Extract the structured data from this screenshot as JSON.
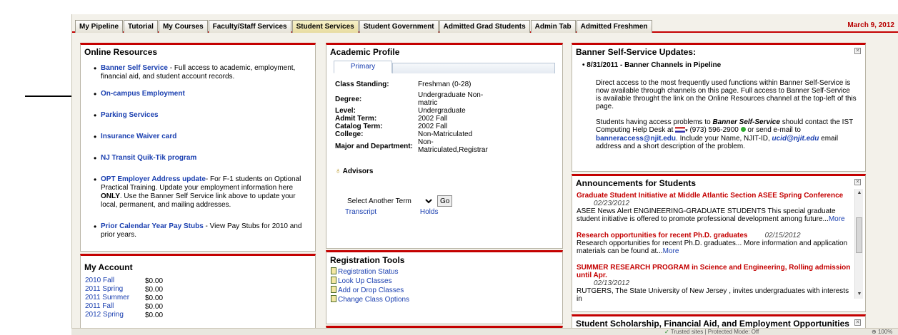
{
  "tabs": [
    "My Pipeline",
    "Tutorial",
    "My Courses",
    "Faculty/Staff Services",
    "Student Services",
    "Student Government",
    "Admitted Grad Students",
    "Admin Tab",
    "Admitted Freshmen"
  ],
  "active_tab": "Student Services",
  "date": "March 9, 2012",
  "online_resources": {
    "title": "Online Resources",
    "items": [
      {
        "link": "Banner Self Service",
        "text": " - Full access to academic, employment, financial aid, and student account records."
      },
      {
        "link": "On-campus Employment",
        "text": ""
      },
      {
        "link": "Parking Services",
        "text": ""
      },
      {
        "link": "Insurance Waiver card",
        "text": ""
      },
      {
        "link": "NJ Transit Quik-Tik program",
        "text": ""
      },
      {
        "link": "OPT Employer Address update",
        "text": "- For F-1 students on Optional Practical Training.  Update your employment information here ",
        "bold": "ONLY",
        "text2": ".  Use the Banner Self Service link above to update your local, permanent, and mailing addresses."
      },
      {
        "link": "Prior Calendar Year Pay Stubs",
        "text": " - View Pay Stubs for 2010 and prior years."
      }
    ]
  },
  "my_account": {
    "title": "My Account",
    "rows": [
      {
        "term": "2010 Fall",
        "amount": "$0.00"
      },
      {
        "term": "2011 Spring",
        "amount": "$0.00"
      },
      {
        "term": "2011 Summer",
        "amount": "$0.00"
      },
      {
        "term": "2011 Fall",
        "amount": "$0.00"
      },
      {
        "term": "2012 Spring",
        "amount": "$0.00"
      }
    ]
  },
  "academic_profile": {
    "title": "Academic Profile",
    "tab": "Primary",
    "rows": [
      {
        "k": "Class Standing:",
        "v": "Freshman (0-28)"
      },
      {
        "k": "Degree:",
        "v": "Undergraduate Non-matric"
      },
      {
        "k": "Level:",
        "v": "Undergraduate"
      },
      {
        "k": "Admit Term:",
        "v": "2002 Fall"
      },
      {
        "k": "Catalog Term:",
        "v": "2002 Fall"
      },
      {
        "k": "College:",
        "v": "Non-Matriculated"
      },
      {
        "k": "Major and Department:",
        "v": "Non-Matriculated,Registrar"
      }
    ],
    "advisors": "Advisors",
    "select_term": "Select Another Term",
    "go": "Go",
    "transcript": "Transcript",
    "holds": "Holds"
  },
  "registration_tools": {
    "title": "Registration Tools",
    "items": [
      "Registration Status",
      "Look Up Classes",
      "Add or Drop Classes",
      "Change Class Options"
    ]
  },
  "banner_updates": {
    "title": "Banner Self-Service Updates:",
    "item_title": "8/31/2011 - Banner Channels in Pipeline",
    "para1": "Direct access to the most frequently used functions within Banner Self-Service is now available through channels on this page. Full access to Banner Self-Service is available throught the link on the Online Resources channel at the top-left of this page.",
    "p2_a": "Students having access problems to ",
    "p2_b": "Banner Self-Service",
    "p2_c": " should contact the IST Computing Help Desk at ",
    "phone": "(973) 596-2900",
    "p2_d": " or send e-mail to ",
    "email": "banneraccess@njit.edu",
    "p2_e": ". Include your Name, NJIT-ID, ",
    "email2": "ucid@njit.edu",
    "p2_f": " email address and a short description of the problem."
  },
  "announcements": {
    "title": "Announcements for Students",
    "items": [
      {
        "title": "Graduate Student Initiative at Middle Atlantic Section ASEE Spring Conference",
        "date": "02/23/2012",
        "body": "ASEE News Alert ENGINEERING-GRADUATE STUDENTS This special graduate student initiative is offered to promote professional development among future...",
        "more": "More"
      },
      {
        "title": "Research opportunities for recent Ph.D. graduates",
        "date": "02/15/2012",
        "body": "Research opportunities for recent Ph.D. graduates... More information and application materials can be found at...",
        "more": "More"
      },
      {
        "title": "SUMMER RESEARCH PROGRAM in Science and Engineering, Rolling admission until Apr.",
        "date": "02/13/2012",
        "body": "RUTGERS, The State University of New Jersey , invites undergraduates with interests in",
        "more": ""
      }
    ]
  },
  "scholarship": {
    "title": "Student Scholarship, Financial Aid, and Employment Opportunities"
  },
  "status": {
    "zone": "Trusted sites | Protected Mode: Off",
    "zoom": "100%"
  }
}
